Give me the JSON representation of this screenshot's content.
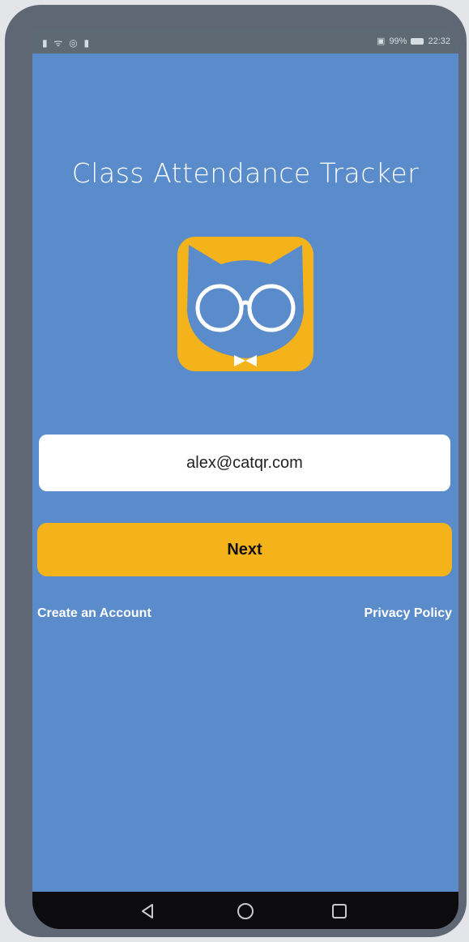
{
  "status_bar": {
    "left_icons": [
      "sim-icon",
      "wifi-icon",
      "sync-icon",
      "notification-icon"
    ],
    "left_text": "▮ ᯤ ◎ ▮",
    "battery_label": "99%",
    "time": "22:32"
  },
  "app": {
    "title": "Class Attendance Tracker",
    "logo_icon": "cat-with-glasses-logo",
    "brand_color": "#5a8ccb",
    "accent_color": "#f5b31b"
  },
  "login": {
    "email_value": "alex@catqr.com",
    "next_label": "Next",
    "create_account_label": "Create an Account",
    "privacy_policy_label": "Privacy Policy"
  },
  "nav_bar": {
    "buttons": [
      "back-icon",
      "home-icon",
      "recents-icon"
    ]
  }
}
